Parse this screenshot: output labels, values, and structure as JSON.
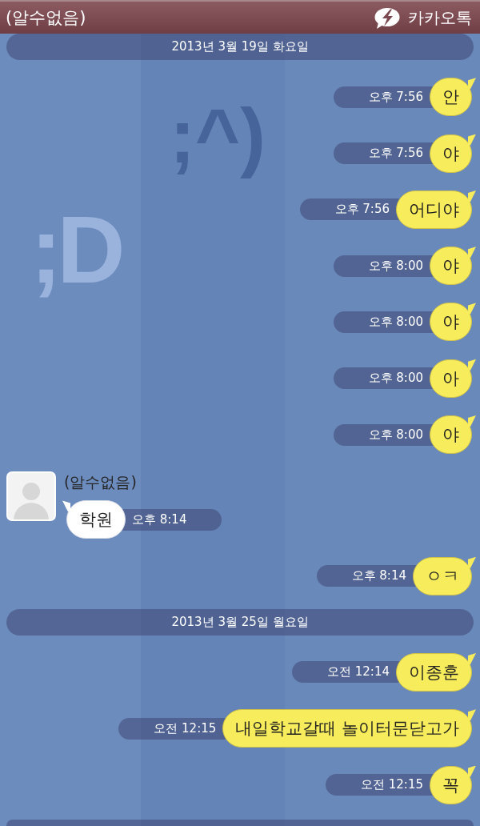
{
  "header": {
    "title": "(알수없음)",
    "app_name": "카카오톡"
  },
  "wallpaper": [
    ";^)",
    ";D"
  ],
  "messages": [
    {
      "kind": "date",
      "text": "2013년 3월 19일 화요일"
    },
    {
      "kind": "sent",
      "text": "안",
      "time": "오후 7:56"
    },
    {
      "kind": "sent",
      "text": "야",
      "time": "오후 7:56"
    },
    {
      "kind": "sent",
      "text": "어디야",
      "time": "오후 7:56"
    },
    {
      "kind": "sent",
      "text": "야",
      "time": "오후 8:00"
    },
    {
      "kind": "sent",
      "text": "야",
      "time": "오후 8:00"
    },
    {
      "kind": "sent",
      "text": "아",
      "time": "오후 8:00"
    },
    {
      "kind": "sent",
      "text": "야",
      "time": "오후 8:00"
    },
    {
      "kind": "received",
      "sender": "(알수없음)",
      "text": "학원",
      "time": "오후 8:14"
    },
    {
      "kind": "sent",
      "text": "ㅇㅋ",
      "time": "오후 8:14"
    },
    {
      "kind": "date",
      "text": "2013년 3월 25일 월요일"
    },
    {
      "kind": "sent",
      "text": "이종훈",
      "time": "오전 12:14"
    },
    {
      "kind": "sent",
      "text": "내일학교갈때 놀이터문닫고가",
      "time": "오전 12:15"
    },
    {
      "kind": "sent",
      "text": "꼭",
      "time": "오전 12:15"
    }
  ]
}
